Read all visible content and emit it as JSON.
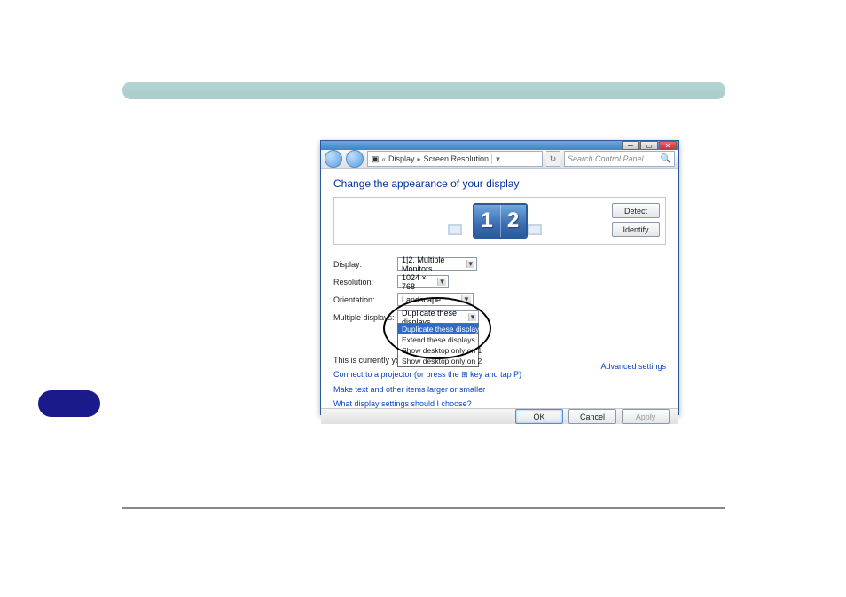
{
  "breadcrumb": {
    "seg1": "Display",
    "seg2": "Screen Resolution"
  },
  "search": {
    "placeholder": "Search Control Panel"
  },
  "page": {
    "title": "Change the appearance of your display"
  },
  "monitors": {
    "num1": "1",
    "num2": "2",
    "detect": "Detect",
    "identify": "Identify"
  },
  "form": {
    "display_label": "Display:",
    "display_value": "1|2. Multiple Monitors",
    "resolution_label": "Resolution:",
    "resolution_value": "1024 × 768",
    "orientation_label": "Orientation:",
    "orientation_value": "Landscape",
    "multi_label": "Multiple displays:",
    "multi_value": "Duplicate these displays",
    "multi_options": {
      "o0": "Duplicate these displays",
      "o1": "Extend these displays",
      "o2": "Show desktop only on 1",
      "o3": "Show desktop only on 2"
    }
  },
  "notes": {
    "current": "This is currently your main display.",
    "advanced": "Advanced settings",
    "projector": "Connect to a projector (or press the",
    "projector_tail": "key and tap P)",
    "textsize": "Make text and other items larger or smaller",
    "help": "What display settings should I choose?"
  },
  "footer": {
    "ok": "OK",
    "cancel": "Cancel",
    "apply": "Apply"
  }
}
